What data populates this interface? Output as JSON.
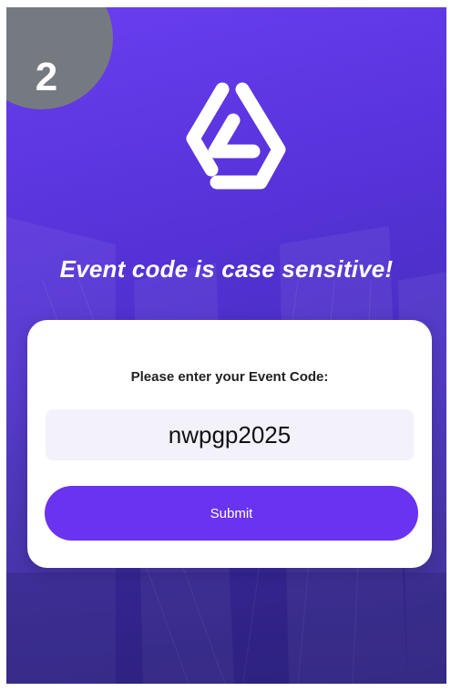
{
  "step": {
    "number": "2"
  },
  "brand": {
    "logo_icon": "brand-logo-icon"
  },
  "headline": "Event code is case sensitive!",
  "form": {
    "label": "Please enter your Event Code:",
    "code_value": "nwpgp2025",
    "submit_label": "Submit"
  },
  "colors": {
    "background_primary": "#5a34e0",
    "badge": "#757a80",
    "button": "#6a33ef",
    "input_background": "#f3f2fb"
  }
}
